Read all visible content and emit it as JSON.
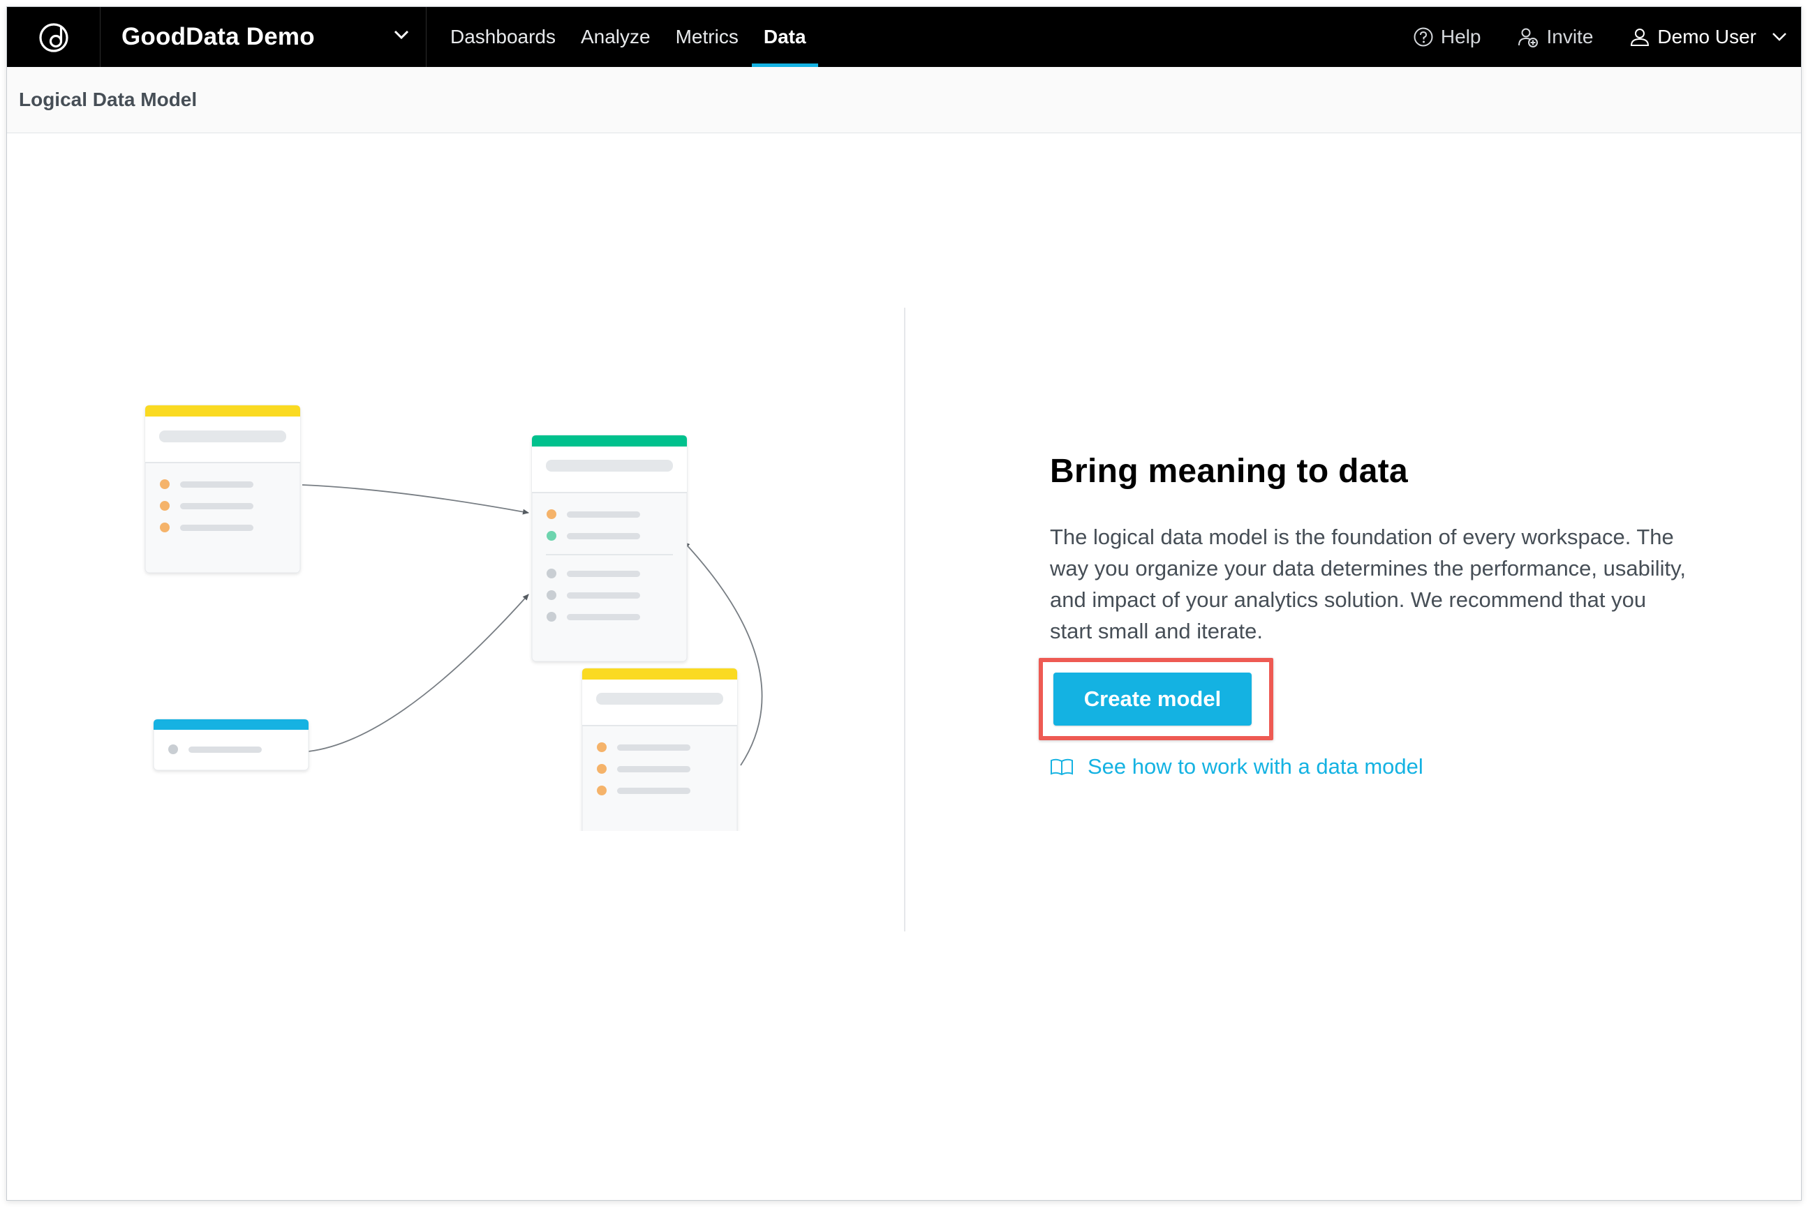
{
  "header": {
    "workspace_name": "GoodData Demo",
    "nav": [
      {
        "label": "Dashboards",
        "active": false
      },
      {
        "label": "Analyze",
        "active": false
      },
      {
        "label": "Metrics",
        "active": false
      },
      {
        "label": "Data",
        "active": true
      }
    ],
    "help_label": "Help",
    "invite_label": "Invite",
    "user_label": "Demo User",
    "icons": [
      "gooddata-logo-icon",
      "chevron-down-icon",
      "help-icon",
      "invite-icon",
      "user-icon"
    ]
  },
  "subheader": {
    "title": "Logical Data Model"
  },
  "main": {
    "headline": "Bring meaning to data",
    "description": "The logical data model is the foundation of every workspace. The way you organize your data determines the performance, usability, and impact of your analytics solution. We recommend that you start small and iterate.",
    "cta_label": "Create model",
    "doc_link_label": "See how to work with a data model",
    "doc_link_icon": "book-icon"
  },
  "colors": {
    "accent": "#14b2e2",
    "highlight_box": "#ee5a53",
    "header_bg": "#000000",
    "dataset_yellow": "#fada23",
    "dataset_green": "#00c18d",
    "dataset_blue": "#14b2e2",
    "attr_orange": "#f5b36a",
    "fact_green": "#6dd4ae",
    "ref_gray": "#c9ced3"
  }
}
